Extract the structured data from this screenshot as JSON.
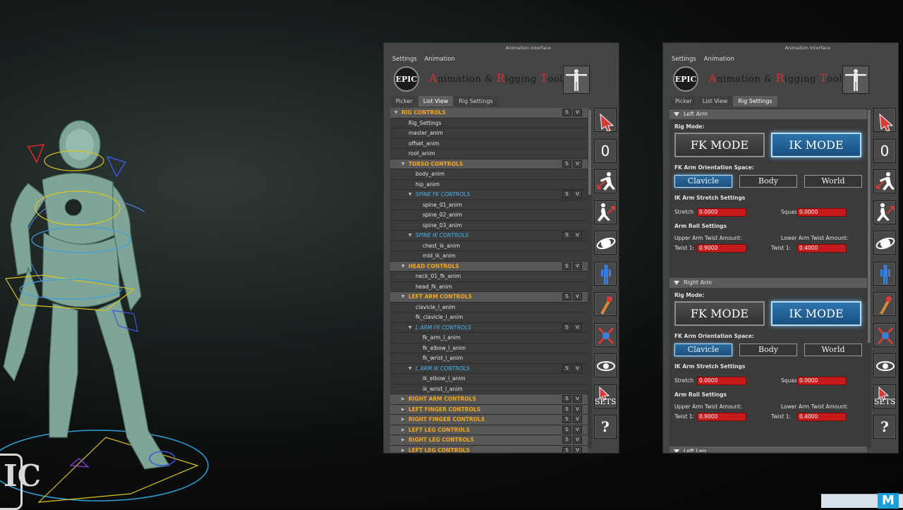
{
  "viewport": {
    "logo_letters": "IC"
  },
  "panels": [
    {
      "window_title": "Animation Interface",
      "menu": [
        "Settings",
        "Animation"
      ],
      "logo_text": "EPIC",
      "tool_title_parts": [
        [
          "A",
          "nimation "
        ],
        [
          "& ",
          ""
        ],
        [
          "R",
          "igging "
        ],
        [
          "T",
          "ools"
        ]
      ],
      "tabs": [
        "Picker",
        "List View",
        "Rig Settings"
      ],
      "active_tab": 1
    },
    {
      "window_title": "Animation Interface",
      "menu": [
        "Settings",
        "Animation"
      ],
      "logo_text": "EPIC",
      "tabs": [
        "Picker",
        "List View",
        "Rig Settings"
      ],
      "active_tab": 2
    }
  ],
  "list_view": {
    "s_label": "S",
    "v_label": "V",
    "rows": [
      {
        "label": "RIG CONTROLS",
        "type": "header",
        "indent": 0,
        "expanded": true
      },
      {
        "label": "Rig_Settings",
        "type": "item",
        "indent": 1
      },
      {
        "label": "master_anim",
        "type": "item",
        "indent": 1
      },
      {
        "label": "offset_anim",
        "type": "item",
        "indent": 1
      },
      {
        "label": "root_anim",
        "type": "item",
        "indent": 1
      },
      {
        "label": "TORSO CONTROLS",
        "type": "header",
        "indent": 1,
        "expanded": true
      },
      {
        "label": "body_anim",
        "type": "item",
        "indent": 2
      },
      {
        "label": "hip_anim",
        "type": "item",
        "indent": 2
      },
      {
        "label": "SPINE FK CONTROLS",
        "type": "sub",
        "indent": 2,
        "expanded": true
      },
      {
        "label": "spine_01_anim",
        "type": "item",
        "indent": 3
      },
      {
        "label": "spine_02_anim",
        "type": "item",
        "indent": 3
      },
      {
        "label": "spine_03_anim",
        "type": "item",
        "indent": 3
      },
      {
        "label": "SPINE IK CONTROLS",
        "type": "sub",
        "indent": 2,
        "expanded": true
      },
      {
        "label": "chest_ik_anim",
        "type": "item",
        "indent": 3
      },
      {
        "label": "mid_ik_anim",
        "type": "item",
        "indent": 3
      },
      {
        "label": "HEAD CONTROLS",
        "type": "header",
        "indent": 1,
        "expanded": true
      },
      {
        "label": "neck_01_fk_anim",
        "type": "item",
        "indent": 2
      },
      {
        "label": "head_fk_anim",
        "type": "item",
        "indent": 2
      },
      {
        "label": "LEFT ARM CONTROLS",
        "type": "header",
        "indent": 1,
        "expanded": true
      },
      {
        "label": "clavicle_l_anim",
        "type": "item",
        "indent": 2
      },
      {
        "label": "fk_clavicle_l_anim",
        "type": "item",
        "indent": 2
      },
      {
        "label": "L ARM FK CONTROLS",
        "type": "sub",
        "indent": 2,
        "expanded": true
      },
      {
        "label": "fk_arm_l_anim",
        "type": "item",
        "indent": 3
      },
      {
        "label": "fk_elbow_l_anim",
        "type": "item",
        "indent": 3
      },
      {
        "label": "fk_wrist_l_anim",
        "type": "item",
        "indent": 3
      },
      {
        "label": "L ARM IK CONTROLS",
        "type": "sub",
        "indent": 2,
        "expanded": true
      },
      {
        "label": "ik_elbow_l_anim",
        "type": "item",
        "indent": 3
      },
      {
        "label": "ik_wrist_l_anim",
        "type": "item",
        "indent": 3
      },
      {
        "label": "RIGHT ARM CONTROLS",
        "type": "header",
        "indent": 1,
        "expanded": false
      },
      {
        "label": "LEFT FINGER CONTROLS",
        "type": "header",
        "indent": 1,
        "expanded": false
      },
      {
        "label": "RIGHT FINGER CONTROLS",
        "type": "header",
        "indent": 1,
        "expanded": false
      },
      {
        "label": "LEFT LEG CONTROLS",
        "type": "header",
        "indent": 1,
        "expanded": false
      },
      {
        "label": "RIGHT LEG CONTROLS",
        "type": "header",
        "indent": 1,
        "expanded": false
      },
      {
        "label": "LEFT LEG CONTROLS",
        "type": "header",
        "indent": 1,
        "expanded": false
      }
    ]
  },
  "toolbar": {
    "reset_label": "0",
    "sets_label": "SETS",
    "help_label": "?",
    "icons": [
      "select-arrow-icon",
      "reset-zero-icon",
      "fk-to-ik-icon",
      "ik-to-fk-icon",
      "space-switch-icon",
      "character-mode-icon",
      "flip-pose-icon",
      "mirror-pose-icon",
      "visibility-eye-icon",
      "selection-sets-icon",
      "help-icon"
    ]
  },
  "rig_settings": {
    "sections": [
      {
        "title": "Left Arm",
        "rig_mode_label": "Rig Mode:",
        "fk_label": "FK MODE",
        "ik_label": "IK MODE",
        "active_mode": "IK",
        "orient_label": "FK Arm Orientation Space:",
        "orient_options": [
          "Clavicle",
          "Body",
          "World"
        ],
        "orient_active": 0,
        "stretch_title": "IK Arm Stretch Settings",
        "stretch_label": "Stretch",
        "stretch_value": "0.0000",
        "squash_label": "Squas",
        "squash_value": "0.0000",
        "roll_title": "Arm Roll Settings",
        "upper_label": "Upper Arm Twist Amount:",
        "lower_label": "Lower Arm Twist Amount:",
        "twist_label": "Twist 1:",
        "upper_value": "0.9000",
        "lower_value": "0.4000"
      },
      {
        "title": "Right Arm",
        "rig_mode_label": "Rig Mode:",
        "fk_label": "FK MODE",
        "ik_label": "IK MODE",
        "active_mode": "IK",
        "orient_label": "FK Arm Orientation Space:",
        "orient_options": [
          "Clavicle",
          "Body",
          "World"
        ],
        "orient_active": 0,
        "stretch_title": "IK Arm Stretch Settings",
        "stretch_label": "Stretch",
        "stretch_value": "0.0000",
        "squash_label": "Squas",
        "squash_value": "0.0000",
        "roll_title": "Arm Roll Settings",
        "upper_label": "Upper Arm Twist Amount:",
        "lower_label": "Lower Arm Twist Amount:",
        "twist_label": "Twist 1:",
        "upper_value": "0.9000",
        "lower_value": "0.4000"
      }
    ],
    "next_section": "Left Leg"
  },
  "taskbar_thumb": {
    "letter": "M"
  },
  "colors": {
    "header_text": "#f0a61c",
    "sub_text": "#49b3ea",
    "field_red": "#c71b1b",
    "active_blue": "#2d74ad"
  }
}
